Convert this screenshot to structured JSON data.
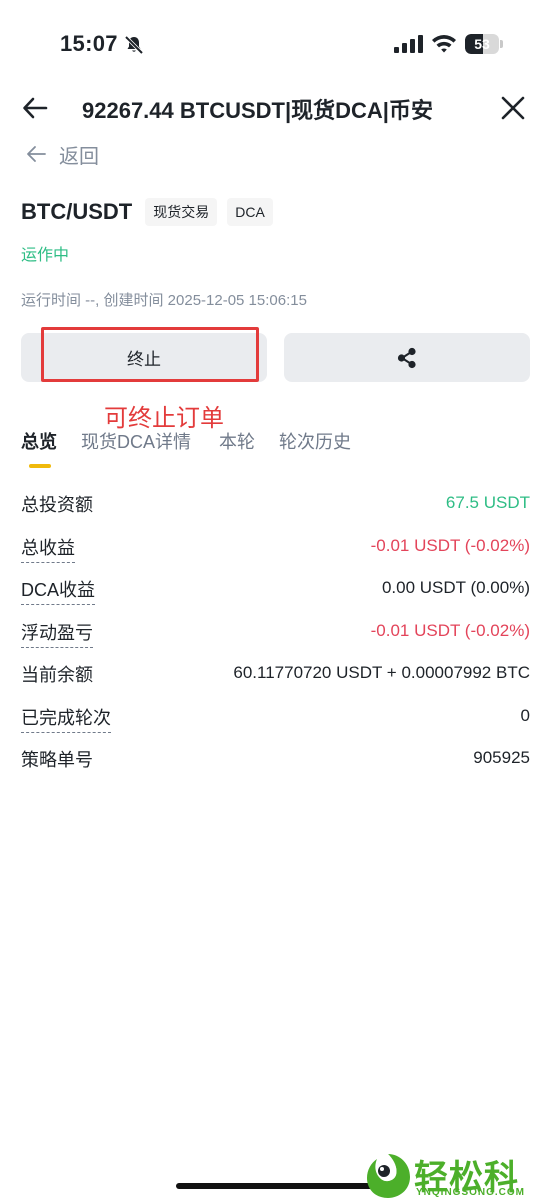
{
  "status_bar": {
    "time": "15:07",
    "battery": "53",
    "battery_level_percent": 53
  },
  "nav": {
    "title": "92267.44 BTCUSDT|现货DCA|币安"
  },
  "sub_nav": {
    "back_label": "返回"
  },
  "header": {
    "pair": "BTC/USDT",
    "tags": [
      "现货交易",
      "DCA"
    ],
    "status": "运作中",
    "meta": "运行时间 --, 创建时间 2025-12-05 15:06:15"
  },
  "actions": {
    "terminate_label": "终止"
  },
  "annotation": "可终止订单",
  "tabs": [
    {
      "label": "总览"
    },
    {
      "label": "现货DCA详情"
    },
    {
      "label": "本轮"
    },
    {
      "label": "轮次历史"
    }
  ],
  "info": [
    {
      "label": "总投资额",
      "value": "67.5  USDT"
    },
    {
      "label": "总收益",
      "value": "-0.01  USDT  (-0.02%)"
    },
    {
      "label": "DCA收益",
      "value": "0.00  USDT  (0.00%)"
    },
    {
      "label": "浮动盈亏",
      "value": "-0.01  USDT  (-0.02%)"
    },
    {
      "label": "当前余额",
      "value": "60.11770720 USDT + 0.00007992 BTC"
    },
    {
      "label": "已完成轮次",
      "value": "0"
    },
    {
      "label": "策略单号",
      "value": "905925"
    }
  ],
  "watermark": {
    "text": "轻松科技",
    "sub": "YNQINGSONG.COM"
  },
  "colors": {
    "profit_green": "#2ebd85",
    "loss_red": "#e3445a",
    "highlight_red": "#e33b3b",
    "tab_indicator": "#f0b90b"
  }
}
